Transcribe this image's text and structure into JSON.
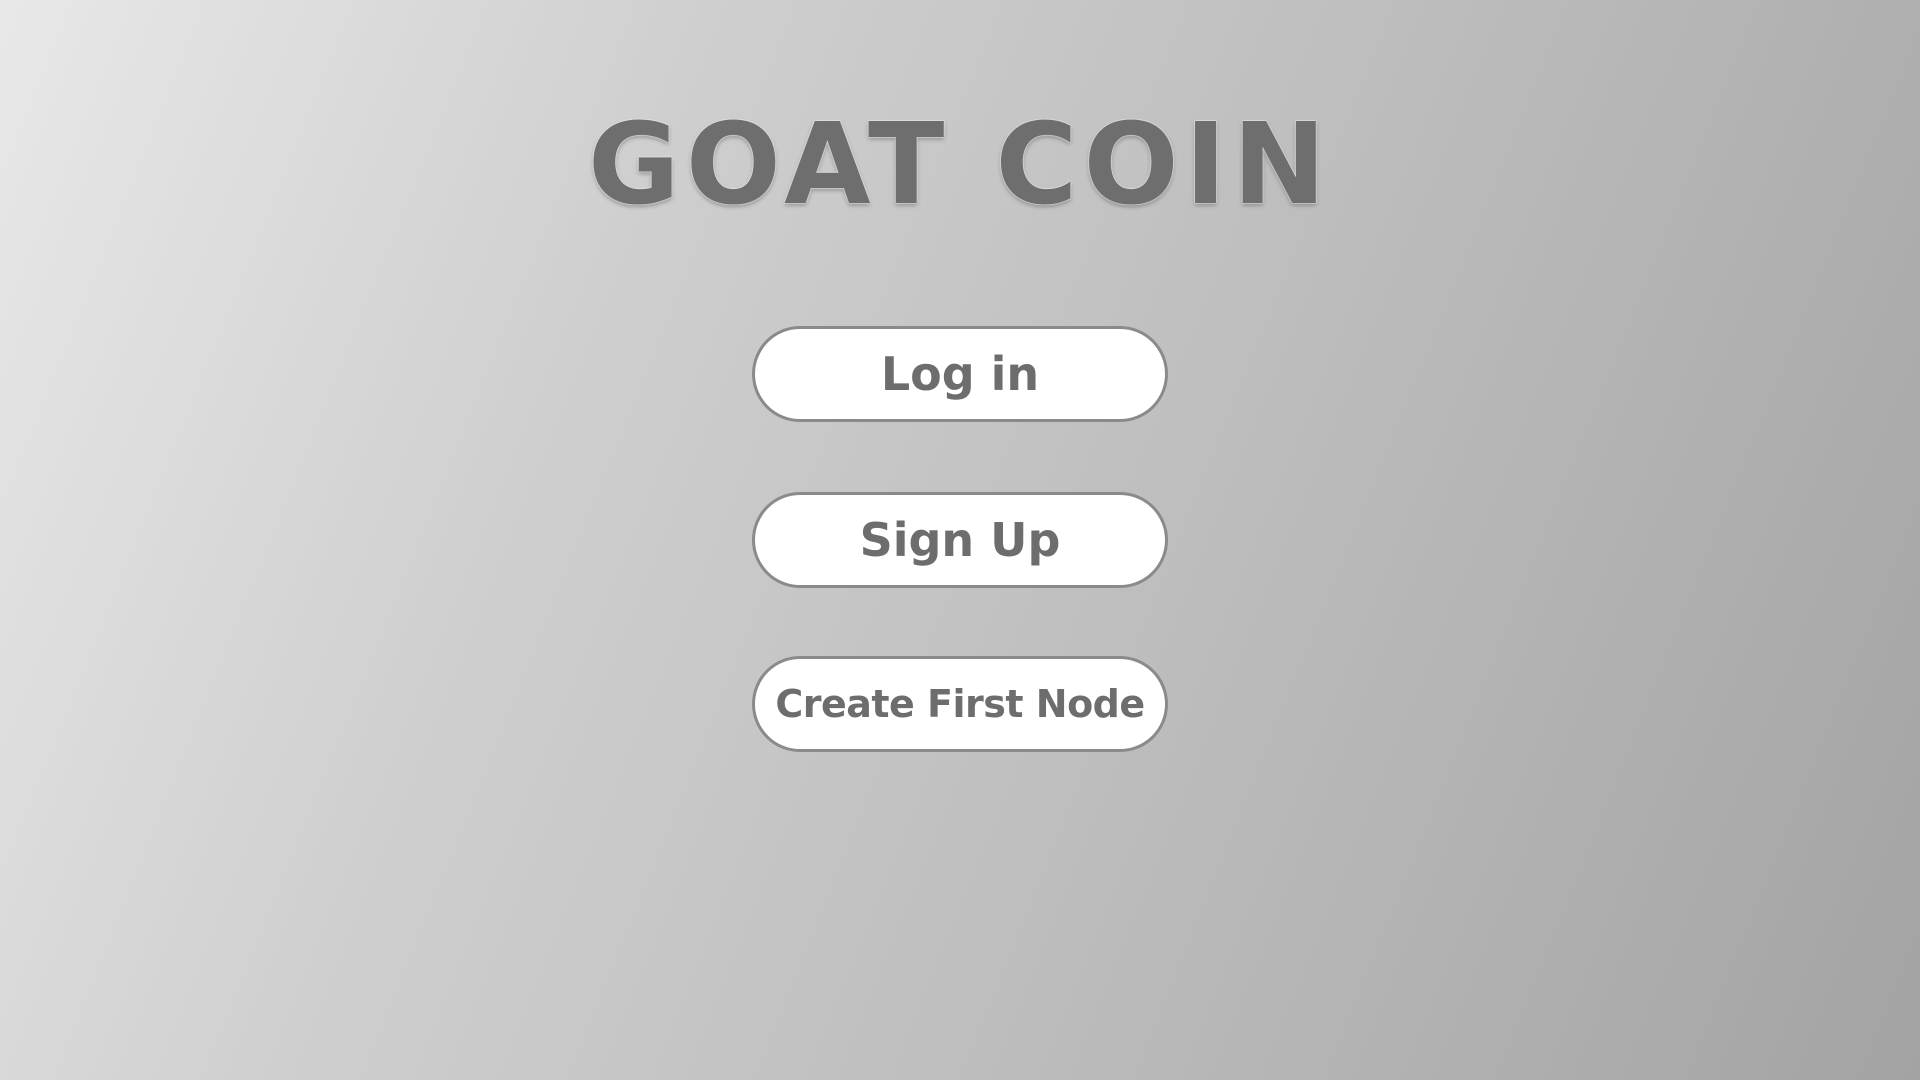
{
  "app": {
    "title": "GOAT COIN"
  },
  "menu": {
    "login_label": "Log in",
    "signup_label": "Sign Up",
    "create_node_label": "Create First Node"
  },
  "colors": {
    "text": "#6d6d6d",
    "button_bg": "#ffffff",
    "button_border": "#8a8a8a",
    "background_light": "#e8e8e8",
    "background_dark": "#a3a3a3"
  }
}
